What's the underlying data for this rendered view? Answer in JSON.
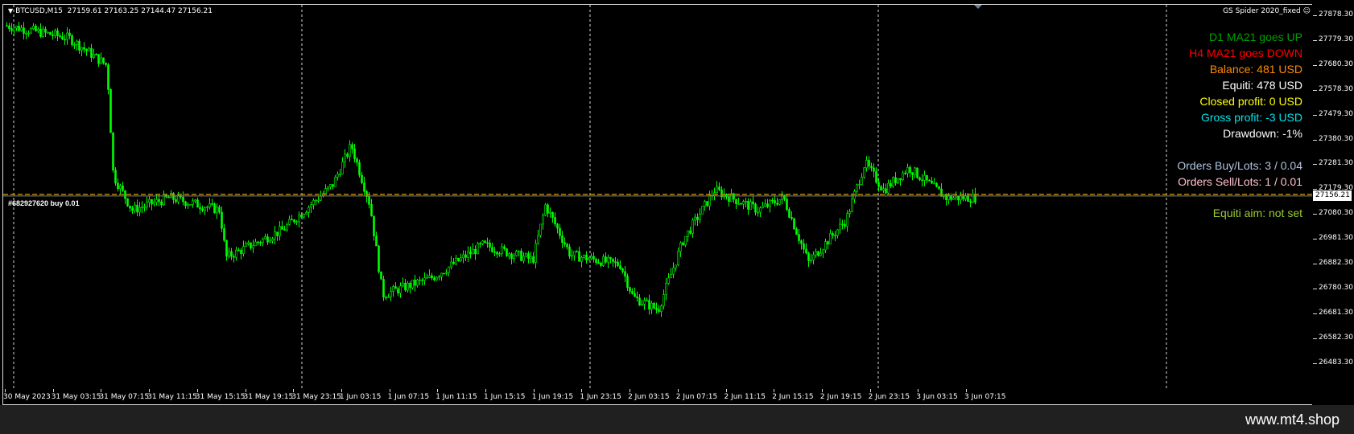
{
  "header": {
    "symbol": "BTCUSD,M15",
    "ohlc": "27159.61 27163.25 27144.47 27156.21",
    "ea_name": "GS Spider 2020_fixed"
  },
  "info": {
    "d1_ma": "D1 MA21 goes UP",
    "h4_ma": "H4 MA21 goes DOWN",
    "balance": "Balance: 481 USD",
    "equity": "Equiti: 478 USD",
    "closed_profit": "Closed profit: 0 USD",
    "gross_profit": "Gross profit: -3 USD",
    "drawdown": "Drawdown: -1%",
    "orders_buy": "Orders Buy/Lots: 3 / 0.04",
    "orders_sell": "Orders Sell/Lots: 1 / 0.01",
    "equity_aim": "Equiti aim: not set"
  },
  "order_label": "#682927620 buy 0.01",
  "current_price": "27156.21",
  "price_axis": [
    "27878.30",
    "27779.30",
    "27680.30",
    "27578.30",
    "27479.30",
    "27380.30",
    "27281.30",
    "27179.30",
    "27080.30",
    "26981.30",
    "26882.30",
    "26780.30",
    "26681.30",
    "26582.30",
    "26483.30"
  ],
  "time_axis": [
    "30 May 2023",
    "31 May 03:15",
    "31 May 07:15",
    "31 May 11:15",
    "31 May 15:15",
    "31 May 19:15",
    "31 May 23:15",
    "1 Jun 03:15",
    "1 Jun 07:15",
    "1 Jun 11:15",
    "1 Jun 15:15",
    "1 Jun 19:15",
    "1 Jun 23:15",
    "2 Jun 03:15",
    "2 Jun 07:15",
    "2 Jun 11:15",
    "2 Jun 15:15",
    "2 Jun 19:15",
    "2 Jun 23:15",
    "3 Jun 03:15",
    "3 Jun 07:15"
  ],
  "colors": {
    "candle": "#00ff00",
    "grid": "#d8d8d8",
    "order_line": "#b8860b",
    "d1_ma": "#00a000",
    "h4_ma": "#ff0000",
    "balance": "#ff8c00",
    "equity": "#ffffff",
    "closed_profit": "#ffff00",
    "gross_profit": "#00e5ee",
    "drawdown": "#ffffff",
    "orders_buy": "#b0c4de",
    "orders_sell": "#ffc0cb",
    "equity_aim": "#9acd32"
  },
  "chart_data": {
    "type": "candlestick",
    "title": "BTCUSD,M15",
    "timeframe": "M15",
    "ylim": [
      26483.3,
      27878.3
    ],
    "current_price": 27156.21,
    "order_line_price": 27163,
    "key_levels": [
      {
        "t": 0,
        "price": 27840
      },
      {
        "t": 0.05,
        "price": 27790
      },
      {
        "t": 0.08,
        "price": 27680
      },
      {
        "t": 0.085,
        "price": 27240
      },
      {
        "t": 0.1,
        "price": 27100
      },
      {
        "t": 0.13,
        "price": 27150
      },
      {
        "t": 0.17,
        "price": 27100
      },
      {
        "t": 0.175,
        "price": 26910
      },
      {
        "t": 0.22,
        "price": 27020
      },
      {
        "t": 0.26,
        "price": 27200
      },
      {
        "t": 0.275,
        "price": 27360
      },
      {
        "t": 0.29,
        "price": 27120
      },
      {
        "t": 0.3,
        "price": 26760
      },
      {
        "t": 0.34,
        "price": 26830
      },
      {
        "t": 0.38,
        "price": 26960
      },
      {
        "t": 0.42,
        "price": 26900
      },
      {
        "t": 0.43,
        "price": 27120
      },
      {
        "t": 0.45,
        "price": 26920
      },
      {
        "t": 0.49,
        "price": 26880
      },
      {
        "t": 0.5,
        "price": 26750
      },
      {
        "t": 0.52,
        "price": 26700
      },
      {
        "t": 0.54,
        "price": 26980
      },
      {
        "t": 0.565,
        "price": 27180
      },
      {
        "t": 0.6,
        "price": 27100
      },
      {
        "t": 0.62,
        "price": 27150
      },
      {
        "t": 0.64,
        "price": 26890
      },
      {
        "t": 0.67,
        "price": 27060
      },
      {
        "t": 0.685,
        "price": 27290
      },
      {
        "t": 0.7,
        "price": 27180
      },
      {
        "t": 0.72,
        "price": 27270
      },
      {
        "t": 0.75,
        "price": 27150
      },
      {
        "t": 0.775,
        "price": 27150
      }
    ]
  },
  "watermark": "www.mt4.shop"
}
